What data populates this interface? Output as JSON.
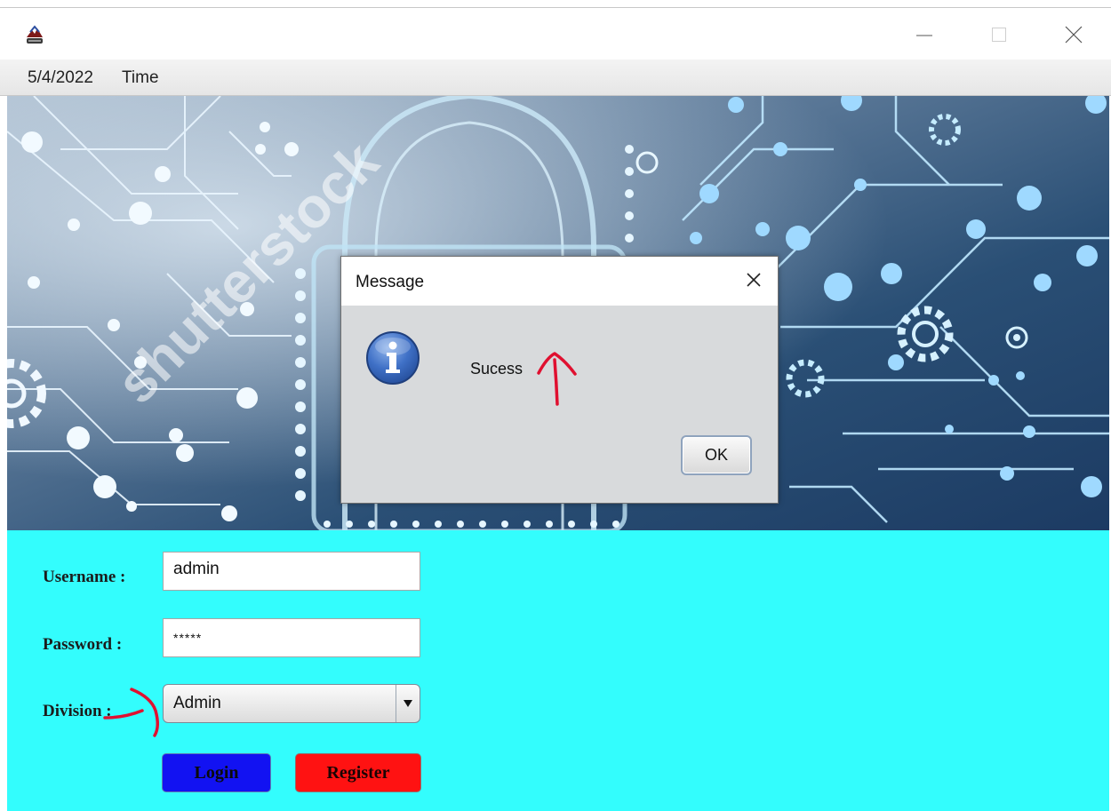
{
  "window": {
    "date": "5/4/2022",
    "time_label": "Time"
  },
  "icons": {
    "app": "java-coffee-cup-icon",
    "minimize": "minimize-icon",
    "maximize": "maximize-icon",
    "close": "close-icon",
    "info": "information-icon",
    "dropdown": "chevron-down-icon"
  },
  "banner": {
    "watermark": "shutterstock"
  },
  "form": {
    "username_label": "Username :",
    "username_value": "admin",
    "password_label": "Password :",
    "password_value": "*****",
    "division_label": "Division :",
    "division_value": "Admin",
    "login_label": "Login",
    "register_label": "Register"
  },
  "dialog": {
    "title": "Message",
    "message": "Sucess",
    "ok_label": "OK"
  },
  "colors": {
    "form_background": "#33fdfd",
    "login_button": "#1212f2",
    "register_button": "#ff1212",
    "annotation_ink": "#e01030"
  }
}
